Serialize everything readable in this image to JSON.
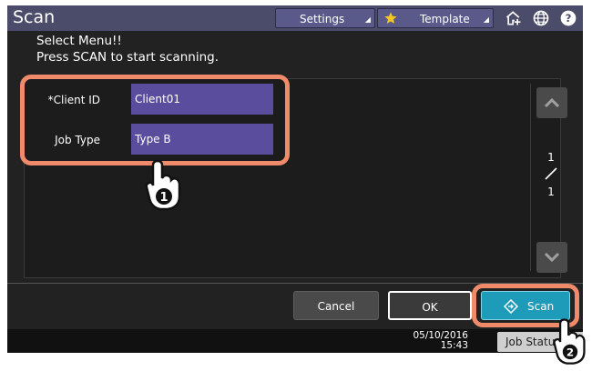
{
  "window": {
    "title": "Scan"
  },
  "toolbar": {
    "settings_label": "Settings",
    "template_label": "Template",
    "icons": [
      "star-icon",
      "home-icon",
      "globe-icon",
      "help-icon"
    ]
  },
  "message": {
    "line1": "Select Menu!!",
    "line2": "Press SCAN to start scanning."
  },
  "fields": {
    "client_id": {
      "label": "*Client ID",
      "value": "Client01"
    },
    "job_type": {
      "label": "Job Type",
      "value": "Type B"
    }
  },
  "pager": {
    "current": "1",
    "total": "1"
  },
  "buttons": {
    "cancel": "Cancel",
    "ok": "OK",
    "scan": "Scan"
  },
  "status": {
    "date": "05/10/2016",
    "time": "15:43",
    "job_status": "Job Status"
  },
  "callouts": {
    "step1": "1",
    "step2": "2"
  },
  "colors": {
    "field_bg": "#5b4d9e",
    "highlight": "#ef8a6b",
    "scan_button": "#1e9bb8",
    "title_bar": "#4b4b6a"
  }
}
